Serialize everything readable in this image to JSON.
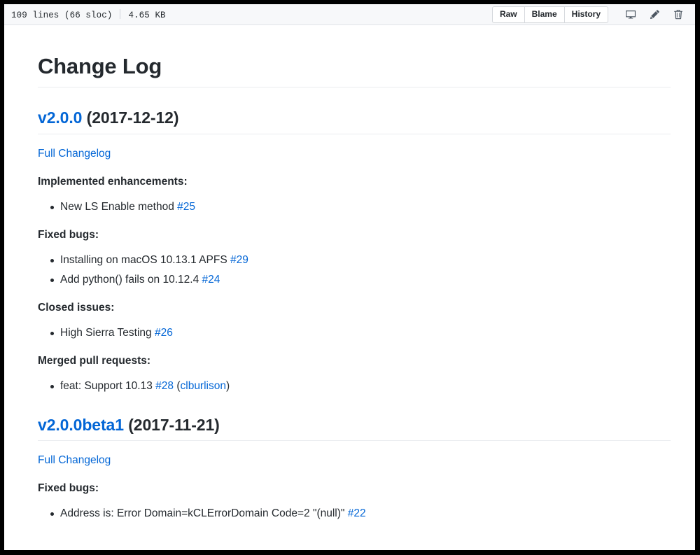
{
  "toolbar": {
    "lines_info": "109 lines (66 sloc)",
    "file_size": "4.65 KB",
    "buttons": [
      {
        "label": "Raw",
        "name": "raw-button"
      },
      {
        "label": "Blame",
        "name": "blame-button"
      },
      {
        "label": "History",
        "name": "history-button"
      }
    ],
    "icons": [
      {
        "name": "desktop-icon",
        "title": "Open in desktop"
      },
      {
        "name": "pencil-icon",
        "title": "Edit this file"
      },
      {
        "name": "trash-icon",
        "title": "Delete this file"
      }
    ]
  },
  "document": {
    "title": "Change Log",
    "releases": [
      {
        "version": "v2.0.0",
        "date": "(2017-12-12)",
        "changelog_link": "Full Changelog",
        "sections": [
          {
            "heading": "Implemented enhancements:",
            "items": [
              {
                "text": "New LS Enable method ",
                "issue": "#25",
                "suffix": ""
              }
            ]
          },
          {
            "heading": "Fixed bugs:",
            "items": [
              {
                "text": "Installing on macOS 10.13.1 APFS ",
                "issue": "#29",
                "suffix": ""
              },
              {
                "text": "Add python() fails on 10.12.4 ",
                "issue": "#24",
                "suffix": ""
              }
            ]
          },
          {
            "heading": "Closed issues:",
            "items": [
              {
                "text": "High Sierra Testing ",
                "issue": "#26",
                "suffix": ""
              }
            ]
          },
          {
            "heading": "Merged pull requests:",
            "items": [
              {
                "text": "feat: Support 10.13 ",
                "issue": "#28",
                "author": "clburlison",
                "suffix": ""
              }
            ]
          }
        ]
      },
      {
        "version": "v2.0.0beta1",
        "date": "(2017-11-21)",
        "changelog_link": "Full Changelog",
        "sections": [
          {
            "heading": "Fixed bugs:",
            "items": [
              {
                "text": "Address is: Error Domain=kCLErrorDomain Code=2 \"(null)\" ",
                "issue": "#22",
                "suffix": ""
              }
            ]
          }
        ]
      }
    ]
  },
  "colors": {
    "link": "#0366d6",
    "text": "#24292e",
    "toolbar_bg": "#f7f8fa",
    "border": "#e1e4e8"
  }
}
